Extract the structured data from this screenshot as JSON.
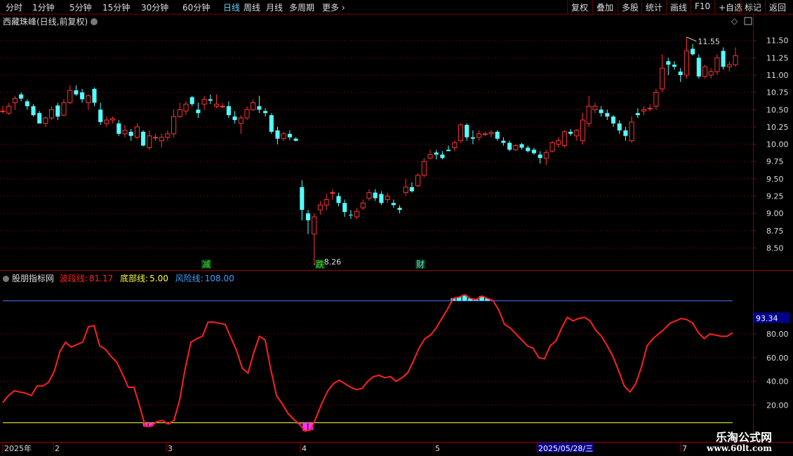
{
  "toolbar": {
    "left_items": [
      "分时",
      "1分钟",
      "5分钟",
      "15分钟",
      "30分钟",
      "60分钟",
      "日线",
      "周线",
      "月线",
      "多周期",
      "更多"
    ],
    "active": "日线",
    "right_items": [
      "复权",
      "叠加",
      "多股",
      "统计",
      "画线",
      "F10",
      "+自选",
      "标记",
      "返回"
    ]
  },
  "main_title": "西藏珠峰(日线,前复权)",
  "price_axis": [
    "11.50",
    "11.25",
    "11.00",
    "10.75",
    "10.50",
    "10.25",
    "10.00",
    "9.75",
    "9.50",
    "9.25",
    "9.00",
    "8.75",
    "8.50"
  ],
  "annotations": {
    "high": "11.55",
    "low": "8.26"
  },
  "signal_labels": [
    {
      "text": "减",
      "color": "#3fdc3f"
    },
    {
      "text": "跌",
      "color": "#3fdc3f"
    },
    {
      "text": "财",
      "color": "#5fd7ff"
    }
  ],
  "indicator": {
    "name": "股朋指标网",
    "line1_label": "波段线:",
    "line1_value": "81.17",
    "line1_color": "#ff2020",
    "line2_label": "底部线:",
    "line2_value": "5.00",
    "line2_color": "#ffff40",
    "line3_label": "风险线:",
    "line3_value": "108.00",
    "line3_color": "#3f7fff",
    "current_tag": "93.34",
    "axis": [
      "80.00",
      "60.00",
      "40.00",
      "20.00"
    ]
  },
  "time_axis": [
    "2025年",
    "2",
    "3",
    "4",
    "5",
    "2025/05/28/三",
    "7"
  ],
  "watermark": {
    "line1": "乐淘公式网",
    "line2": "www.60lt.com"
  },
  "chart_data": [
    {
      "type": "candlestick",
      "title": "西藏珠峰(日线,前复权)",
      "ylim": [
        8.2,
        11.7
      ],
      "candles": [
        [
          10.48,
          10.56,
          10.45,
          10.48
        ],
        [
          10.45,
          10.6,
          10.42,
          10.55
        ],
        [
          10.6,
          10.7,
          10.5,
          10.66
        ],
        [
          10.72,
          10.75,
          10.62,
          10.66
        ],
        [
          10.62,
          10.65,
          10.5,
          10.55
        ],
        [
          10.55,
          10.58,
          10.4,
          10.42
        ],
        [
          10.45,
          10.48,
          10.3,
          10.3
        ],
        [
          10.3,
          10.4,
          10.25,
          10.38
        ],
        [
          10.38,
          10.55,
          10.35,
          10.5
        ],
        [
          10.56,
          10.6,
          10.35,
          10.4
        ],
        [
          10.42,
          10.65,
          10.4,
          10.6
        ],
        [
          10.6,
          10.85,
          10.58,
          10.78
        ],
        [
          10.78,
          10.85,
          10.7,
          10.72
        ],
        [
          10.75,
          10.8,
          10.6,
          10.65
        ],
        [
          10.6,
          10.72,
          10.5,
          10.7
        ],
        [
          10.8,
          10.82,
          10.55,
          10.6
        ],
        [
          10.5,
          10.6,
          10.28,
          10.32
        ],
        [
          10.3,
          10.4,
          10.25,
          10.35
        ],
        [
          10.35,
          10.4,
          10.3,
          10.37
        ],
        [
          10.3,
          10.35,
          10.12,
          10.15
        ],
        [
          10.15,
          10.28,
          10.1,
          10.2
        ],
        [
          10.18,
          10.22,
          10.05,
          10.12
        ],
        [
          10.1,
          10.3,
          10.08,
          10.25
        ],
        [
          10.18,
          10.2,
          9.97,
          9.98
        ],
        [
          9.95,
          10.2,
          9.92,
          10.12
        ],
        [
          10.1,
          10.15,
          10.05,
          10.1
        ],
        [
          10.05,
          10.15,
          9.95,
          10.1
        ],
        [
          10.1,
          10.2,
          10.05,
          10.15
        ],
        [
          10.15,
          10.5,
          10.1,
          10.4
        ],
        [
          10.4,
          10.6,
          10.38,
          10.5
        ],
        [
          10.48,
          10.62,
          10.42,
          10.58
        ],
        [
          10.68,
          10.7,
          10.55,
          10.58
        ],
        [
          10.5,
          10.6,
          10.38,
          10.45
        ],
        [
          10.58,
          10.7,
          10.5,
          10.65
        ],
        [
          10.65,
          10.72,
          10.58,
          10.63
        ],
        [
          10.55,
          10.72,
          10.52,
          10.58
        ],
        [
          10.55,
          10.6,
          10.52,
          10.55
        ],
        [
          10.55,
          10.62,
          10.38,
          10.42
        ],
        [
          10.4,
          10.48,
          10.3,
          10.35
        ],
        [
          10.3,
          10.42,
          10.15,
          10.38
        ],
        [
          10.38,
          10.55,
          10.35,
          10.5
        ],
        [
          10.5,
          10.65,
          10.48,
          10.6
        ],
        [
          10.55,
          10.7,
          10.45,
          10.5
        ],
        [
          10.48,
          10.52,
          10.4,
          10.45
        ],
        [
          10.42,
          10.45,
          10.15,
          10.18
        ],
        [
          10.2,
          10.25,
          10.0,
          10.08
        ],
        [
          10.08,
          10.18,
          10.05,
          10.15
        ],
        [
          10.15,
          10.2,
          10.06,
          10.1
        ],
        [
          10.08,
          10.1,
          10.04,
          10.05
        ],
        [
          9.38,
          9.48,
          8.9,
          9.05
        ],
        [
          9.0,
          9.05,
          8.7,
          8.9
        ],
        [
          8.7,
          9.0,
          8.26,
          8.95
        ],
        [
          9.05,
          9.18,
          8.98,
          9.12
        ],
        [
          9.12,
          9.28,
          9.05,
          9.2
        ],
        [
          9.3,
          9.35,
          9.2,
          9.3
        ],
        [
          9.25,
          9.3,
          9.1,
          9.15
        ],
        [
          9.15,
          9.2,
          8.95,
          9.02
        ],
        [
          8.98,
          9.05,
          8.92,
          8.97
        ],
        [
          8.95,
          9.08,
          8.92,
          9.03
        ],
        [
          9.08,
          9.2,
          9.05,
          9.15
        ],
        [
          9.22,
          9.35,
          9.18,
          9.3
        ],
        [
          9.3,
          9.35,
          9.18,
          9.22
        ],
        [
          9.28,
          9.32,
          9.12,
          9.15
        ],
        [
          9.2,
          9.3,
          9.15,
          9.25
        ],
        [
          9.15,
          9.2,
          9.08,
          9.12
        ],
        [
          9.08,
          9.12,
          9.0,
          9.05
        ],
        [
          9.3,
          9.5,
          9.25,
          9.38
        ],
        [
          9.38,
          9.45,
          9.3,
          9.32
        ],
        [
          9.4,
          9.58,
          9.38,
          9.55
        ],
        [
          9.55,
          9.8,
          9.52,
          9.75
        ],
        [
          9.8,
          9.92,
          9.78,
          9.85
        ],
        [
          9.88,
          9.92,
          9.78,
          9.85
        ],
        [
          9.85,
          9.9,
          9.78,
          9.8
        ],
        [
          9.92,
          9.98,
          9.9,
          9.9
        ],
        [
          9.95,
          10.05,
          9.9,
          10.02
        ],
        [
          10.05,
          10.3,
          10.02,
          10.28
        ],
        [
          10.28,
          10.3,
          10.05,
          10.1
        ],
        [
          10.1,
          10.2,
          10.0,
          10.08
        ],
        [
          10.1,
          10.2,
          10.05,
          10.15
        ],
        [
          10.15,
          10.18,
          10.12,
          10.15
        ],
        [
          10.15,
          10.2,
          10.1,
          10.17
        ],
        [
          10.18,
          10.2,
          10.05,
          10.08
        ],
        [
          10.05,
          10.1,
          9.98,
          10.02
        ],
        [
          10.02,
          10.05,
          9.9,
          9.92
        ],
        [
          9.92,
          10.0,
          9.9,
          9.98
        ],
        [
          10.0,
          10.02,
          9.92,
          9.95
        ],
        [
          9.95,
          9.98,
          9.88,
          9.9
        ],
        [
          9.92,
          9.95,
          9.85,
          9.87
        ],
        [
          9.85,
          9.9,
          9.72,
          9.8
        ],
        [
          9.8,
          9.92,
          9.7,
          9.88
        ],
        [
          9.9,
          10.05,
          9.88,
          10.02
        ],
        [
          10.0,
          10.1,
          9.95,
          10.05
        ],
        [
          9.98,
          10.2,
          9.95,
          10.18
        ],
        [
          10.18,
          10.22,
          10.12,
          10.15
        ],
        [
          10.12,
          10.22,
          10.05,
          10.2
        ],
        [
          10.05,
          10.45,
          10.0,
          10.35
        ],
        [
          10.3,
          10.7,
          10.25,
          10.55
        ],
        [
          10.5,
          10.6,
          10.45,
          10.55
        ],
        [
          10.5,
          10.55,
          10.4,
          10.45
        ],
        [
          10.45,
          10.5,
          10.35,
          10.4
        ],
        [
          10.4,
          10.42,
          10.25,
          10.3
        ],
        [
          10.3,
          10.35,
          10.15,
          10.2
        ],
        [
          10.2,
          10.25,
          10.05,
          10.12
        ],
        [
          10.05,
          10.4,
          10.02,
          10.32
        ],
        [
          10.45,
          10.52,
          10.38,
          10.42
        ],
        [
          10.48,
          10.55,
          10.42,
          10.5
        ],
        [
          10.52,
          10.58,
          10.48,
          10.52
        ],
        [
          10.55,
          10.8,
          10.5,
          10.75
        ],
        [
          10.8,
          11.3,
          10.75,
          11.1
        ],
        [
          11.2,
          11.25,
          11.0,
          11.15
        ],
        [
          11.15,
          11.2,
          11.08,
          11.12
        ],
        [
          11.05,
          11.1,
          10.9,
          11.0
        ],
        [
          11.0,
          11.55,
          10.95,
          11.35
        ],
        [
          11.38,
          11.45,
          11.28,
          11.3
        ],
        [
          11.25,
          11.3,
          10.95,
          10.98
        ],
        [
          10.98,
          11.15,
          10.95,
          11.12
        ],
        [
          11.0,
          11.1,
          10.95,
          11.05
        ],
        [
          11.05,
          11.3,
          11.0,
          11.25
        ],
        [
          11.35,
          11.4,
          11.08,
          11.12
        ],
        [
          11.12,
          11.2,
          11.05,
          11.15
        ],
        [
          11.15,
          11.4,
          11.12,
          11.28
        ]
      ]
    },
    {
      "type": "line",
      "title": "股朋指标网",
      "ylim": [
        -10,
        125
      ],
      "series": [
        {
          "name": "波段线",
          "color": "#ff2020",
          "values": [
            22,
            28,
            32,
            31,
            30,
            28,
            36,
            36,
            39,
            48,
            65,
            73,
            69,
            71,
            73,
            86,
            87,
            70,
            67,
            61,
            56,
            46,
            35,
            35,
            19,
            2,
            2,
            6,
            7,
            4,
            7,
            24,
            51,
            73,
            76,
            78,
            90,
            90,
            89,
            88,
            77,
            66,
            51,
            47,
            64,
            78,
            75,
            50,
            28,
            21,
            13,
            8,
            4,
            -2,
            -1,
            10,
            22,
            32,
            38,
            41,
            38,
            35,
            33,
            34,
            40,
            44,
            45,
            43,
            44,
            40,
            43,
            47,
            57,
            68,
            76,
            79,
            85,
            93,
            101,
            110,
            111,
            113,
            110,
            109,
            112,
            110,
            108,
            100,
            88,
            85,
            80,
            75,
            70,
            68,
            60,
            59,
            70,
            74,
            85,
            94,
            91,
            93,
            94,
            91,
            83,
            78,
            70,
            61,
            49,
            36,
            31,
            38,
            52,
            70,
            76,
            80,
            84,
            89,
            91,
            93,
            92,
            89,
            81,
            76,
            80,
            79,
            78,
            78,
            81
          ]
        },
        {
          "name": "底部线",
          "color": "#ffff40",
          "values": [
            5
          ]
        },
        {
          "name": "风险线",
          "color": "#3f7fff",
          "values": [
            108
          ]
        }
      ]
    }
  ]
}
